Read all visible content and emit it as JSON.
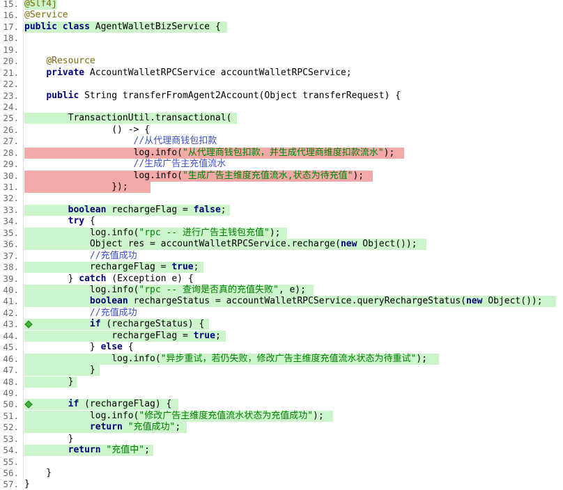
{
  "editor": {
    "lines": [
      {
        "num": "15.",
        "text": "@Slf4j",
        "hl": "g",
        "hlStart": 35,
        "hlEnd": 82
      },
      {
        "num": "16.",
        "text": "@Service",
        "hl": "",
        "hlStart": 0,
        "hlEnd": 0
      },
      {
        "num": "17.",
        "text": "public class AgentWalletBizService {",
        "hl": "g",
        "hlStart": 35,
        "hlEnd": 326
      },
      {
        "num": "18.",
        "text": "",
        "hl": "",
        "hlStart": 0,
        "hlEnd": 0
      },
      {
        "num": "19.",
        "text": "",
        "hl": "",
        "hlStart": 0,
        "hlEnd": 0
      },
      {
        "num": "20.",
        "text": "    @Resource",
        "hl": "",
        "hlStart": 0,
        "hlEnd": 0
      },
      {
        "num": "21.",
        "text": "    private AccountWalletRPCService accountWalletRPCService;",
        "hl": "",
        "hlStart": 0,
        "hlEnd": 0
      },
      {
        "num": "22.",
        "text": "",
        "hl": "",
        "hlStart": 0,
        "hlEnd": 0
      },
      {
        "num": "23.",
        "text": "    public String transferFromAgent2Account(Object transferRequest) {",
        "hl": "",
        "hlStart": 0,
        "hlEnd": 0
      },
      {
        "num": "24.",
        "text": "",
        "hl": "",
        "hlStart": 0,
        "hlEnd": 0
      },
      {
        "num": "25.",
        "text": "        TransactionUtil.transactional(",
        "hl": "g",
        "hlStart": 35,
        "hlEnd": 340
      },
      {
        "num": "26.",
        "text": "                () -> {",
        "hl": "",
        "hlStart": 0,
        "hlEnd": 0
      },
      {
        "num": "27.",
        "text": "                    //从代理商钱包扣款",
        "hl": "",
        "hlStart": 0,
        "hlEnd": 0
      },
      {
        "num": "28.",
        "text": "                    log.info(\"从代理商钱包扣款，并生成代理商维度扣款流水\");",
        "hl": "r",
        "hlStart": 35,
        "hlEnd": 580
      },
      {
        "num": "29.",
        "text": "                    //生成广告主充值流水",
        "hl": "",
        "hlStart": 0,
        "hlEnd": 0
      },
      {
        "num": "30.",
        "text": "                    log.info(\"生成广告主维度充值流水,状态为待充值\");",
        "hl": "r",
        "hlStart": 35,
        "hlEnd": 535
      },
      {
        "num": "31.",
        "text": "                });",
        "hl": "r",
        "hlStart": 35,
        "hlEnd": 216
      },
      {
        "num": "32.",
        "text": "",
        "hl": "",
        "hlStart": 0,
        "hlEnd": 0
      },
      {
        "num": "33.",
        "text": "        boolean rechargeFlag = false;",
        "hl": "g",
        "hlStart": 35,
        "hlEnd": 330
      },
      {
        "num": "34.",
        "text": "        try {",
        "hl": "",
        "hlStart": 0,
        "hlEnd": 0
      },
      {
        "num": "35.",
        "text": "            log.info(\"rpc -- 进行广告主钱包充值\");",
        "hl": "g",
        "hlStart": 35,
        "hlEnd": 412
      },
      {
        "num": "36.",
        "text": "            Object res = accountWalletRPCService.recharge(new Object());",
        "hl": "g",
        "hlStart": 35,
        "hlEnd": 612
      },
      {
        "num": "37.",
        "text": "            //充值成功",
        "hl": "",
        "hlStart": 0,
        "hlEnd": 0
      },
      {
        "num": "38.",
        "text": "            rechargeFlag = true;",
        "hl": "g",
        "hlStart": 35,
        "hlEnd": 292
      },
      {
        "num": "39.",
        "text": "        } catch (Exception e) {",
        "hl": "",
        "hlStart": 0,
        "hlEnd": 0
      },
      {
        "num": "40.",
        "text": "            log.info(\"rpc -- 查询是否真的充值失败\", e);",
        "hl": "g",
        "hlStart": 35,
        "hlEnd": 450
      },
      {
        "num": "41.",
        "text": "            boolean rechargeStatus = accountWalletRPCService.queryRechargeStatus(new Object());",
        "hl": "g",
        "hlStart": 35,
        "hlEnd": 798
      },
      {
        "num": "42.",
        "text": "            //充值成功",
        "hl": "",
        "hlStart": 0,
        "hlEnd": 0
      },
      {
        "num": "43.",
        "text": "            if (rechargeStatus) {",
        "hl": "g",
        "hlStart": 35,
        "hlEnd": 300,
        "marker": true
      },
      {
        "num": "44.",
        "text": "                rechargeFlag = true;",
        "hl": "g",
        "hlStart": 35,
        "hlEnd": 324
      },
      {
        "num": "45.",
        "text": "            } else {",
        "hl": "",
        "hlStart": 0,
        "hlEnd": 0
      },
      {
        "num": "46.",
        "text": "                log.info(\"异步重试，若仍失败，修改广告主维度充值流水状态为待重试\");",
        "hl": "g",
        "hlStart": 35,
        "hlEnd": 630
      },
      {
        "num": "47.",
        "text": "            }",
        "hl": "g",
        "hlStart": 35,
        "hlEnd": 143
      },
      {
        "num": "48.",
        "text": "        }",
        "hl": "g",
        "hlStart": 35,
        "hlEnd": 110
      },
      {
        "num": "49.",
        "text": "",
        "hl": "",
        "hlStart": 0,
        "hlEnd": 0
      },
      {
        "num": "50.",
        "text": "        if (rechargeFlag) {",
        "hl": "g",
        "hlStart": 35,
        "hlEnd": 256,
        "marker": true
      },
      {
        "num": "51.",
        "text": "            log.info(\"修改广告主维度充值流水状态为充值成功\");",
        "hl": "g",
        "hlStart": 35,
        "hlEnd": 478
      },
      {
        "num": "52.",
        "text": "            return \"充值成功\";",
        "hl": "g",
        "hlStart": 35,
        "hlEnd": 268
      },
      {
        "num": "53.",
        "text": "        }",
        "hl": "",
        "hlStart": 0,
        "hlEnd": 0
      },
      {
        "num": "54.",
        "text": "        return \"充值中\";",
        "hl": "g",
        "hlStart": 35,
        "hlEnd": 220
      },
      {
        "num": "55.",
        "text": "",
        "hl": "",
        "hlStart": 0,
        "hlEnd": 0
      },
      {
        "num": "56.",
        "text": "    }",
        "hl": "",
        "hlStart": 0,
        "hlEnd": 0
      },
      {
        "num": "57.",
        "text": "}",
        "hl": "",
        "hlStart": 0,
        "hlEnd": 0
      }
    ],
    "firstLineTop": 4,
    "lineHeight": 16.44
  }
}
